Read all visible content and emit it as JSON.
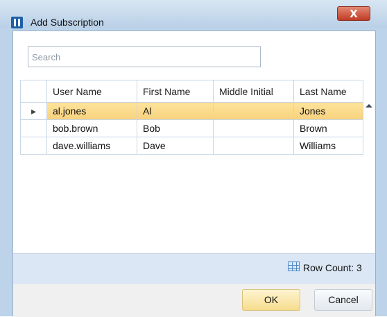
{
  "window": {
    "title": "Add Subscription",
    "close_glyph": "X"
  },
  "search": {
    "placeholder": "Search"
  },
  "table": {
    "headers": [
      "User Name",
      "First Name",
      "Middle Initial",
      "Last Name"
    ],
    "rows": [
      {
        "user_name": "al.jones",
        "first_name": "Al",
        "middle_initial": "",
        "last_name": "Jones",
        "selected": true
      },
      {
        "user_name": "bob.brown",
        "first_name": "Bob",
        "middle_initial": "",
        "last_name": "Brown",
        "selected": false
      },
      {
        "user_name": "dave.williams",
        "first_name": "Dave",
        "middle_initial": "",
        "last_name": "Williams",
        "selected": false
      }
    ],
    "selected_indicator": "▸"
  },
  "status": {
    "row_count_label": "Row Count: 3"
  },
  "buttons": {
    "ok_label": "OK",
    "cancel_label": "Cancel"
  },
  "icons": {
    "app": "app-icon",
    "close": "close-icon",
    "row_count": "grid-icon",
    "scroll_up": "scroll-up-icon",
    "scroll_down": "scroll-down-icon"
  },
  "colors": {
    "selected_row": "#f8d27e",
    "close_button": "#c13b24",
    "accent": "#dbe7f5"
  }
}
